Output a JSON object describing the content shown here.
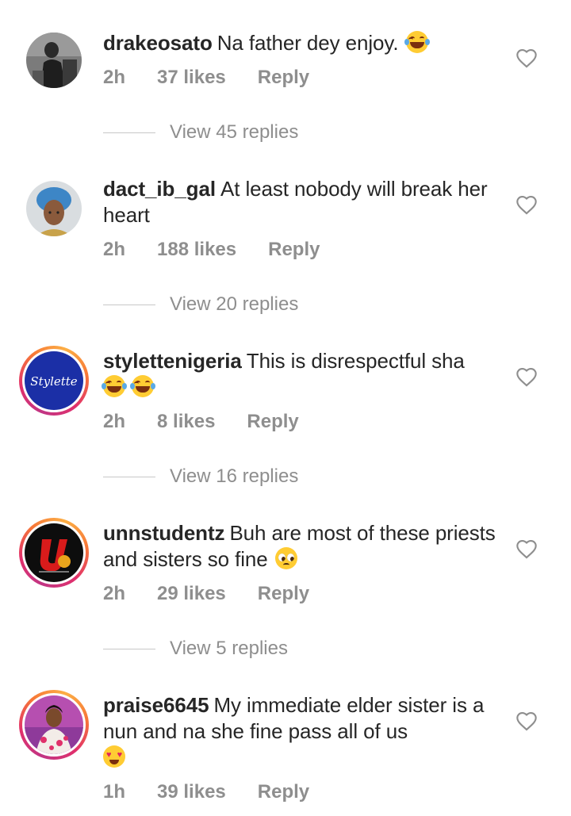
{
  "comments": [
    {
      "username": "drakeosato",
      "text": "Na father dey enjoy.",
      "emoji": [
        "laughing-tears"
      ],
      "time": "2h",
      "likes": "37 likes",
      "reply": "Reply",
      "view_replies": "View 45 replies"
    },
    {
      "username": "dact_ib_gal",
      "text": "At least nobody will break her heart",
      "emoji": [],
      "time": "2h",
      "likes": "188 likes",
      "reply": "Reply",
      "view_replies": "View 20 replies"
    },
    {
      "username": "stylettenigeria",
      "text": "This is disrespectful sha",
      "emoji": [
        "laughing-tears",
        "laughing-tears"
      ],
      "time": "2h",
      "likes": "8 likes",
      "reply": "Reply",
      "view_replies": "View 16 replies",
      "avatar_logo": "Stylette"
    },
    {
      "username": "unnstudentz",
      "text": "Buh are most of these priests and sisters so fine",
      "emoji": [
        "pleading-face"
      ],
      "time": "2h",
      "likes": "29 likes",
      "reply": "Reply",
      "view_replies": "View 5 replies"
    },
    {
      "username": "praise6645",
      "text": "My immediate elder sister is a nun and na she fine pass all of us",
      "emoji": [
        "heart-eyes"
      ],
      "time": "1h",
      "likes": "39 likes",
      "reply": "Reply"
    }
  ],
  "colors": {
    "text": "#262626",
    "muted": "#8e8e8e",
    "story_ring_start": "#c13584",
    "story_ring_end": "#fcaf45"
  }
}
